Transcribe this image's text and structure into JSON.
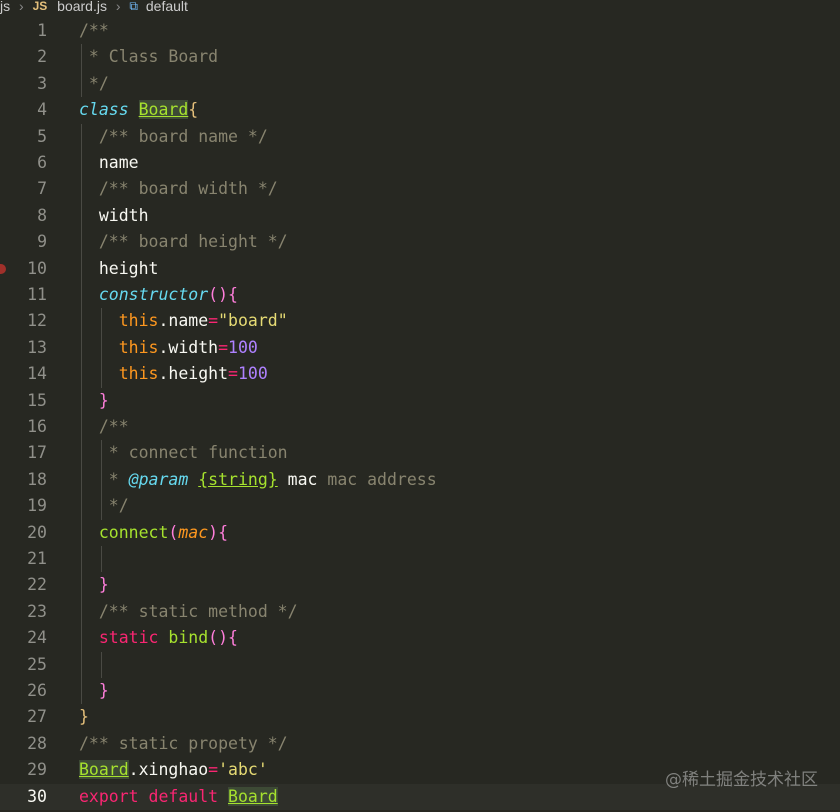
{
  "breadcrumb": {
    "folder": "js",
    "file_badge": "JS",
    "file": "board.js",
    "symbol_icon": "symbol-variable-icon",
    "symbol": "default"
  },
  "editor": {
    "current_line": 30,
    "breakpoint_line": 10,
    "lines": [
      {
        "n": "1",
        "tokens": [
          [
            "c",
            "/**"
          ]
        ]
      },
      {
        "n": "2",
        "tokens": [
          [
            "c",
            " * Class Board"
          ]
        ]
      },
      {
        "n": "3",
        "tokens": [
          [
            "c",
            " */"
          ]
        ]
      },
      {
        "n": "4",
        "tokens": [
          [
            "kw",
            "class"
          ],
          [
            "p",
            " "
          ],
          [
            "cls",
            "Board"
          ],
          [
            "br",
            "{"
          ]
        ]
      },
      {
        "n": "5",
        "tokens": [
          [
            "p",
            "  "
          ],
          [
            "c",
            "/** board name */"
          ]
        ]
      },
      {
        "n": "6",
        "tokens": [
          [
            "p",
            "  name"
          ]
        ]
      },
      {
        "n": "7",
        "tokens": [
          [
            "p",
            "  "
          ],
          [
            "c",
            "/** board width */"
          ]
        ]
      },
      {
        "n": "8",
        "tokens": [
          [
            "p",
            "  width"
          ]
        ]
      },
      {
        "n": "9",
        "tokens": [
          [
            "p",
            "  "
          ],
          [
            "c",
            "/** board height */"
          ]
        ]
      },
      {
        "n": "10",
        "tokens": [
          [
            "p",
            "  height"
          ]
        ]
      },
      {
        "n": "11",
        "tokens": [
          [
            "p",
            "  "
          ],
          [
            "fn",
            "constructor"
          ],
          [
            "br2",
            "(){"
          ]
        ]
      },
      {
        "n": "12",
        "tokens": [
          [
            "p",
            "    "
          ],
          [
            "this",
            "this"
          ],
          [
            "p",
            ".name"
          ],
          [
            "op",
            "="
          ],
          [
            "str",
            "\"board\""
          ]
        ]
      },
      {
        "n": "13",
        "tokens": [
          [
            "p",
            "    "
          ],
          [
            "this",
            "this"
          ],
          [
            "p",
            ".width"
          ],
          [
            "op",
            "="
          ],
          [
            "num",
            "100"
          ]
        ]
      },
      {
        "n": "14",
        "tokens": [
          [
            "p",
            "    "
          ],
          [
            "this",
            "this"
          ],
          [
            "p",
            ".height"
          ],
          [
            "op",
            "="
          ],
          [
            "num",
            "100"
          ]
        ]
      },
      {
        "n": "15",
        "tokens": [
          [
            "p",
            "  "
          ],
          [
            "br2",
            "}"
          ]
        ]
      },
      {
        "n": "16",
        "tokens": [
          [
            "p",
            "  "
          ],
          [
            "c",
            "/**"
          ]
        ]
      },
      {
        "n": "17",
        "tokens": [
          [
            "p",
            "  "
          ],
          [
            "c",
            " * connect function"
          ]
        ]
      },
      {
        "n": "18",
        "tokens": [
          [
            "p",
            "  "
          ],
          [
            "c",
            " * "
          ],
          [
            "tag",
            "@param"
          ],
          [
            "p",
            " "
          ],
          [
            "type",
            "{string}"
          ],
          [
            "p",
            " mac "
          ],
          [
            "c",
            "mac address"
          ]
        ]
      },
      {
        "n": "19",
        "tokens": [
          [
            "p",
            "  "
          ],
          [
            "c",
            " */"
          ]
        ]
      },
      {
        "n": "20",
        "tokens": [
          [
            "p",
            "  "
          ],
          [
            "m",
            "connect"
          ],
          [
            "br2",
            "("
          ],
          [
            "prm",
            "mac"
          ],
          [
            "br2",
            "){"
          ]
        ]
      },
      {
        "n": "21",
        "tokens": []
      },
      {
        "n": "22",
        "tokens": [
          [
            "p",
            "  "
          ],
          [
            "br2",
            "}"
          ]
        ]
      },
      {
        "n": "23",
        "tokens": [
          [
            "p",
            "  "
          ],
          [
            "c",
            "/** static method */"
          ]
        ]
      },
      {
        "n": "24",
        "tokens": [
          [
            "p",
            "  "
          ],
          [
            "op",
            "static"
          ],
          [
            "p",
            " "
          ],
          [
            "m",
            "bind"
          ],
          [
            "br2",
            "(){"
          ]
        ]
      },
      {
        "n": "25",
        "tokens": []
      },
      {
        "n": "26",
        "tokens": [
          [
            "p",
            "  "
          ],
          [
            "br2",
            "}"
          ]
        ]
      },
      {
        "n": "27",
        "tokens": [
          [
            "br",
            "}"
          ]
        ]
      },
      {
        "n": "28",
        "tokens": [
          [
            "c",
            "/** static propety */"
          ]
        ]
      },
      {
        "n": "29",
        "tokens": [
          [
            "cls",
            "Board"
          ],
          [
            "p",
            ".xinghao"
          ],
          [
            "op",
            "="
          ],
          [
            "str",
            "'abc'"
          ]
        ]
      },
      {
        "n": "30",
        "tokens": [
          [
            "op",
            "export"
          ],
          [
            "p",
            " "
          ],
          [
            "op",
            "default"
          ],
          [
            "p",
            " "
          ],
          [
            "cls",
            "Board"
          ]
        ]
      }
    ]
  },
  "watermark": "@稀土掘金技术社区",
  "colors": {
    "background": "#272822",
    "comment": "#88846f",
    "keyword": "#66d9ef",
    "class_name": "#a6e22e",
    "string": "#e6db74",
    "number": "#ae81ff",
    "operator": "#f92672",
    "this": "#fd971f"
  }
}
